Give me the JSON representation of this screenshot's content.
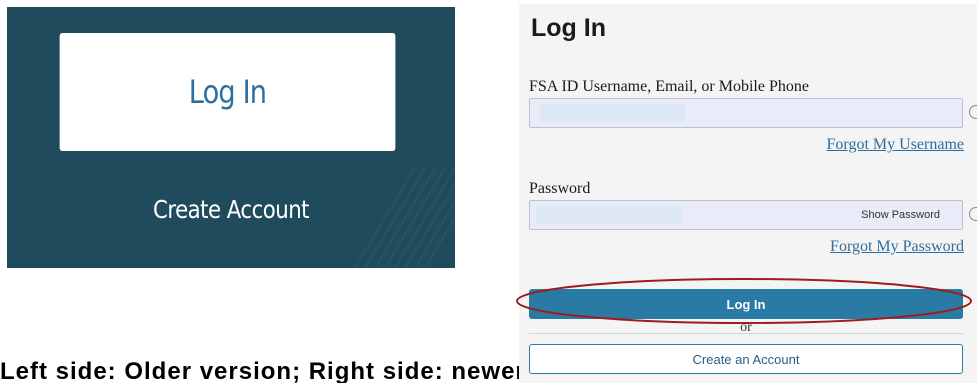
{
  "left_panel": {
    "login_button": "Log In",
    "create_account_link": "Create Account"
  },
  "bottom_text": "Left side: Older version; Right side: newer version",
  "right_panel": {
    "title": "Log In",
    "username_label": "FSA ID Username, Email, or Mobile Phone",
    "forgot_username": "Forgot My Username",
    "password_label": "Password",
    "show_password": "Show Password",
    "forgot_password": "Forgot My Password",
    "login_button": "Log In",
    "or_text": "or",
    "create_account_button": "Create an Account"
  },
  "colors": {
    "left_panel_bg": "#1f4b5c",
    "primary_blue": "#2a7aa6",
    "link_blue": "#2e6d9e",
    "highlight_red": "#a01c1c"
  },
  "icons": [
    "help-icon",
    "help-icon"
  ]
}
